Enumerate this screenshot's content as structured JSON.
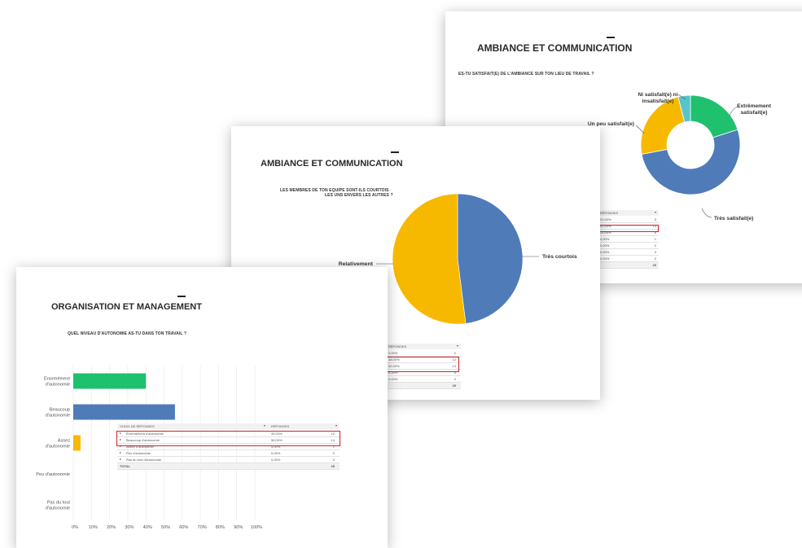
{
  "slide3": {
    "title": "AMBIANCE ET COMMUNICATION",
    "question": "ES-TU SATISFAIT(E) DE L'AMBIANCE SUR TON LIEU DE TRAVAIL ?",
    "table_header": "RÉPONSES",
    "rows": [
      [
        "20,00%",
        "5"
      ],
      [
        "52,00%",
        "13"
      ],
      [
        "24,00%",
        "6"
      ],
      [
        "4,00%",
        "1"
      ],
      [
        "0,00%",
        "0"
      ],
      [
        "0,00%",
        "0"
      ],
      [
        "0,00%",
        "0"
      ]
    ],
    "total": "25"
  },
  "slide2": {
    "title": "AMBIANCE ET COMMUNICATION",
    "question_line1": "LES MEMBRES DE TON EQUIPE SONT-ILS COURTOIS",
    "question_line2": "LES UNS ENVERS LES AUTRES ?",
    "table_header": "RÉPONSES",
    "rows": [
      [
        "0,00%",
        "0"
      ],
      [
        "48,00%",
        "12"
      ],
      [
        "52,00%",
        "13"
      ],
      [
        "0,00%",
        "0"
      ],
      [
        "0,00%",
        "0"
      ]
    ],
    "total": "25"
  },
  "slide1": {
    "title": "ORGANISATION ET MANAGEMENT",
    "question": "QUEL NIVEAU D'AUTONOMIE AS-TU DANS TON TRAVAIL ?",
    "table_header_choices": "CHOIX DE RÉPONSES",
    "table_header_responses": "RÉPONSES",
    "rows": [
      [
        "Énormément d'autonomie",
        "40,00%",
        "10"
      ],
      [
        "Beaucoup d'autonomie",
        "56,00%",
        "14"
      ],
      [
        "Assez d'autonomie",
        "4,00%",
        "1"
      ],
      [
        "Peu d'autonomie",
        "0,00%",
        "0"
      ],
      [
        "Pas du tout d'autonomie",
        "0,00%",
        "0"
      ]
    ],
    "total_label": "TOTAL",
    "total": "25"
  },
  "colors": {
    "green": "#1fc06e",
    "blue": "#4f7bb9",
    "yellow": "#f7b900",
    "teal": "#55c5c9",
    "highlight": "#d21f26"
  },
  "chart_data": [
    {
      "type": "pie",
      "donut": true,
      "title": "ES-TU SATISFAIT(E) DE L'AMBIANCE SUR TON LIEU DE TRAVAIL ?",
      "labels": [
        "Extrêmement satisfait(e)",
        "Très satisfait(e)",
        "Un peu satisfait(e)",
        "Ni satisfait(e) ni insatisfait(e)"
      ],
      "label_lines": [
        [
          "Extrêmement",
          "satisfait(e)"
        ],
        [
          "Très satisfait(e)"
        ],
        [
          "Un peu satisfait(e)"
        ],
        [
          "Ni satisfait(e) ni",
          "insatisfait(e)"
        ]
      ],
      "values": [
        20,
        52,
        24,
        4
      ],
      "colors": [
        "#1fc06e",
        "#4f7bb9",
        "#f7b900",
        "#55c5c9"
      ]
    },
    {
      "type": "pie",
      "donut": false,
      "title": "LES MEMBRES DE TON EQUIPE SONT-ILS COURTOIS LES UNS ENVERS LES AUTRES ?",
      "labels": [
        "Très courtois",
        "Relativement"
      ],
      "values": [
        48,
        52
      ],
      "colors": [
        "#4f7bb9",
        "#f7b900"
      ]
    },
    {
      "type": "bar",
      "orientation": "horizontal",
      "title": "QUEL NIVEAU D'AUTONOMIE AS-TU DANS TON TRAVAIL ?",
      "categories": [
        "Énormément d'autonomie",
        "Beaucoup d'autonomie",
        "Assez d'autonomie",
        "Peu d'autonomie",
        "Pas du tout d'autonomie"
      ],
      "category_lines": [
        [
          "Énormément",
          "d'autonomie"
        ],
        [
          "Beaucoup",
          "d'autonomie"
        ],
        [
          "Assez",
          "d'autonomie"
        ],
        [
          "Peu d'autonomie"
        ],
        [
          "Pas du tout",
          "d'autonomie"
        ]
      ],
      "values": [
        40,
        56,
        4,
        0,
        0
      ],
      "colors": [
        "#1fc06e",
        "#4f7bb9",
        "#f7b900",
        "#f7b900",
        "#f7b900"
      ],
      "xticks": [
        "0%",
        "10%",
        "20%",
        "30%",
        "40%",
        "50%",
        "60%",
        "70%",
        "80%",
        "90%",
        "100%"
      ],
      "xlim": [
        0,
        100
      ],
      "grid": true
    }
  ]
}
